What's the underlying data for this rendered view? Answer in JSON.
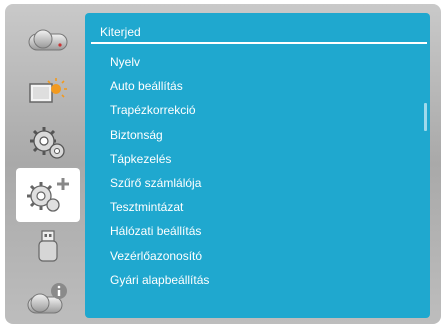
{
  "sidebar": {
    "items": [
      {
        "icon": "projector-icon",
        "active": false
      },
      {
        "icon": "display-brightness-icon",
        "active": false
      },
      {
        "icon": "gear-icon",
        "active": false
      },
      {
        "icon": "gear-plus-icon",
        "active": true
      },
      {
        "icon": "usb-icon",
        "active": false
      },
      {
        "icon": "projector-info-icon",
        "active": false
      }
    ]
  },
  "panel": {
    "title": "Kiterjed",
    "items": [
      "Nyelv",
      "Auto beállítás",
      "Trapézkorrekció",
      "Biztonság",
      "Tápkezelés",
      "Szűrő számlálója",
      "Tesztmintázat",
      "Hálózati beállítás",
      "Vezérlőazonosító",
      "Gyári alapbeállítás"
    ]
  },
  "colors": {
    "accent": "#1fa8cf",
    "frame": "#b5b5b5",
    "text": "#ffffff"
  }
}
